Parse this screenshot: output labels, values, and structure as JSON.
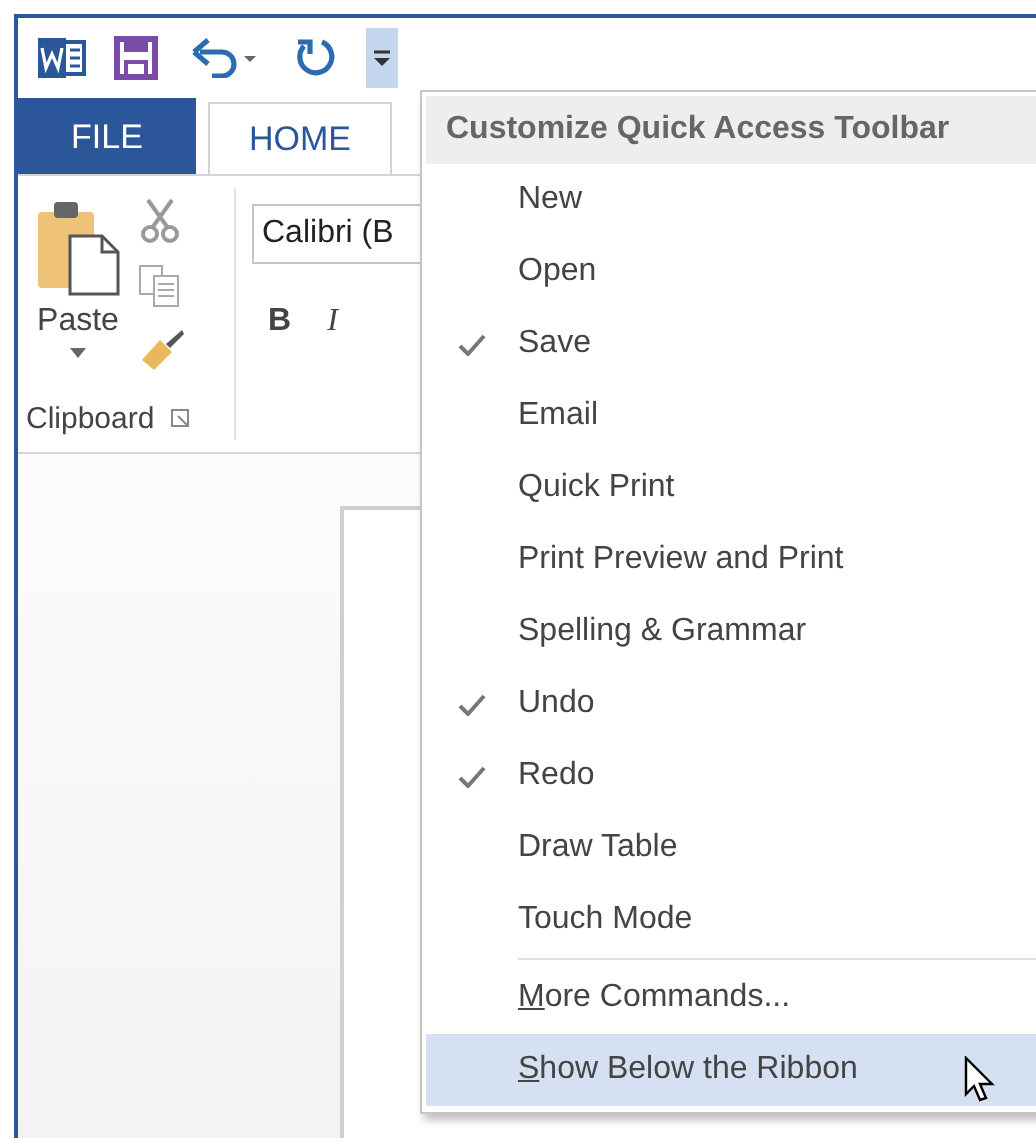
{
  "tabs": [
    {
      "label": "FILE",
      "kind": "file",
      "selected": false
    },
    {
      "label": "HOME",
      "kind": "tab",
      "selected": true
    }
  ],
  "ribbon": {
    "paste_label": "Paste",
    "font_name": "Calibri (B",
    "format_buttons": [
      "B",
      "I"
    ],
    "group_label": "Clipboard"
  },
  "menu": {
    "title": "Customize Quick Access Toolbar",
    "items": [
      {
        "label": "New",
        "checked": false
      },
      {
        "label": "Open",
        "checked": false
      },
      {
        "label": "Save",
        "checked": true
      },
      {
        "label": "Email",
        "checked": false
      },
      {
        "label": "Quick Print",
        "checked": false
      },
      {
        "label": "Print Preview and Print",
        "checked": false
      },
      {
        "label": "Spelling & Grammar",
        "checked": false
      },
      {
        "label": "Undo",
        "checked": true
      },
      {
        "label": "Redo",
        "checked": true
      },
      {
        "label": "Draw Table",
        "checked": false
      },
      {
        "label": "Touch Mode",
        "checked": false
      }
    ],
    "commands": [
      {
        "key": "M",
        "rest": "ore Commands...",
        "selected": false
      },
      {
        "key": "S",
        "rest": "how Below the Ribbon",
        "selected": true
      }
    ]
  }
}
